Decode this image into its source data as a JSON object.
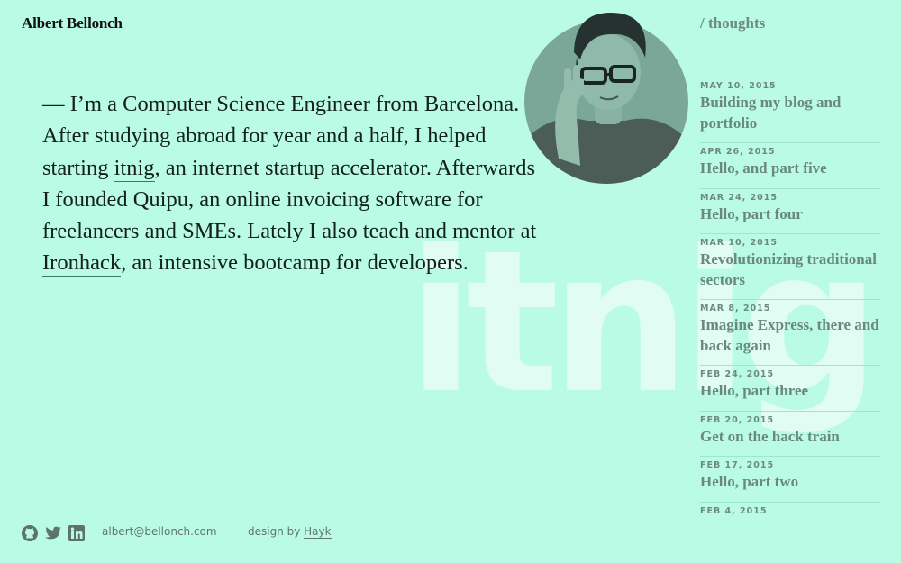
{
  "site": {
    "name": "Albert Bellonch"
  },
  "watermark": "itnig",
  "bio": {
    "p1": "— I’m a Computer Science Engineer from Barcelona. After studying abroad for year and a half, I helped starting ",
    "link1": "itnig",
    "p2": ", an internet startup accelerator. Afterwards I founded ",
    "link2": "Quipu",
    "p3": ", an online invoicing software for freelancers and SMEs. Lately I also teach and mentor at ",
    "link3": "Ironhack",
    "p4": ", an intensive bootcamp for developers."
  },
  "sidebar": {
    "title": "/ thoughts",
    "posts": [
      {
        "date": "MAY 10, 2015",
        "title": "Building my blog and portfolio"
      },
      {
        "date": "APR 26, 2015",
        "title": "Hello, and part five"
      },
      {
        "date": "MAR 24, 2015",
        "title": "Hello, part four"
      },
      {
        "date": "MAR 10, 2015",
        "title": "Revolutionizing traditional sectors"
      },
      {
        "date": "MAR 8, 2015",
        "title": "Imagine Express, there and back again"
      },
      {
        "date": "FEB 24, 2015",
        "title": "Hello, part three"
      },
      {
        "date": "FEB 20, 2015",
        "title": "Get on the hack train"
      },
      {
        "date": "FEB 17, 2015",
        "title": "Hello, part two"
      },
      {
        "date": "FEB 4, 2015",
        "title": ""
      }
    ]
  },
  "footer": {
    "email": "albert@bellonch.com",
    "credit_prefix": "design by ",
    "credit_name": "Hayk",
    "icons": [
      "github-icon",
      "twitter-icon",
      "linkedin-icon"
    ]
  },
  "colors": {
    "background": "#b9fbe4",
    "accent_muted": "#6a8880",
    "avatar_tint": "#6c9888"
  }
}
